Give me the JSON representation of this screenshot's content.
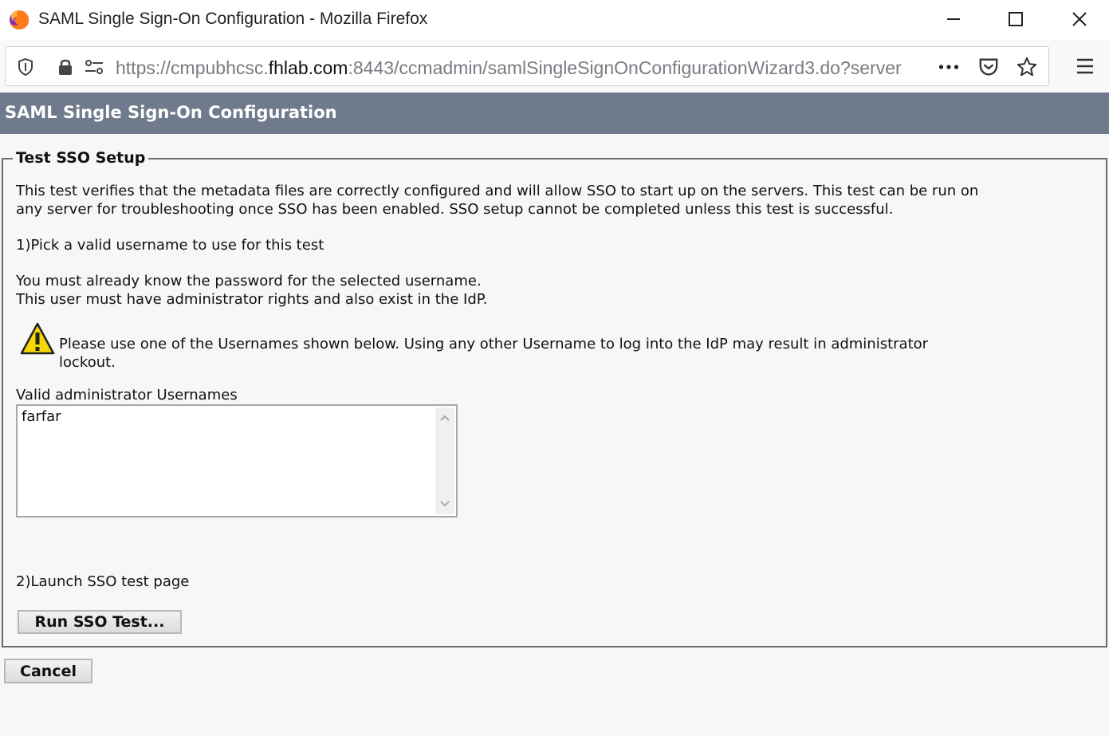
{
  "window": {
    "title": "SAML Single Sign-On Configuration - Mozilla Firefox",
    "controls": {
      "minimize": "minimize-icon",
      "maximize": "maximize-icon",
      "close": "close-icon"
    }
  },
  "navbar": {
    "url_prefix": "https://cmpubhcsc.",
    "url_domain": "fhlab.com",
    "url_suffix": ":8443/ccmadmin/samlSingleSignOnConfigurationWizard3.do?server",
    "icons": [
      "shield-icon",
      "lock-icon",
      "permissions-icon",
      "page-actions-icon",
      "pocket-icon",
      "bookmark-star-icon",
      "hamburger-menu-icon"
    ]
  },
  "header": {
    "title": "SAML Single Sign-On Configuration"
  },
  "section": {
    "legend": "Test SSO Setup",
    "intro_line1": "This test verifies that the metadata files are correctly configured and will allow SSO to start up on the servers. This test can be run on",
    "intro_line2": "any server for troubleshooting once SSO has been enabled. SSO setup cannot be completed unless this test is successful.",
    "step1": "1)Pick a valid username to use for this test",
    "note_line1": "You must already know the password for the selected username.",
    "note_line2": "This user must have administrator rights and also exist in the IdP.",
    "warning_line1": "Please use one of the Usernames shown below. Using any other Username to log into the IdP may result in administrator",
    "warning_line2": "lockout.",
    "usernames_label": "Valid administrator Usernames",
    "usernames": [
      "farfar"
    ],
    "step2": "2)Launch SSO test page",
    "run_button": "Run SSO Test..."
  },
  "footer": {
    "cancel_button": "Cancel"
  },
  "colors": {
    "header_band": "#6f7a8c",
    "warning_yellow": "#f5d800"
  }
}
